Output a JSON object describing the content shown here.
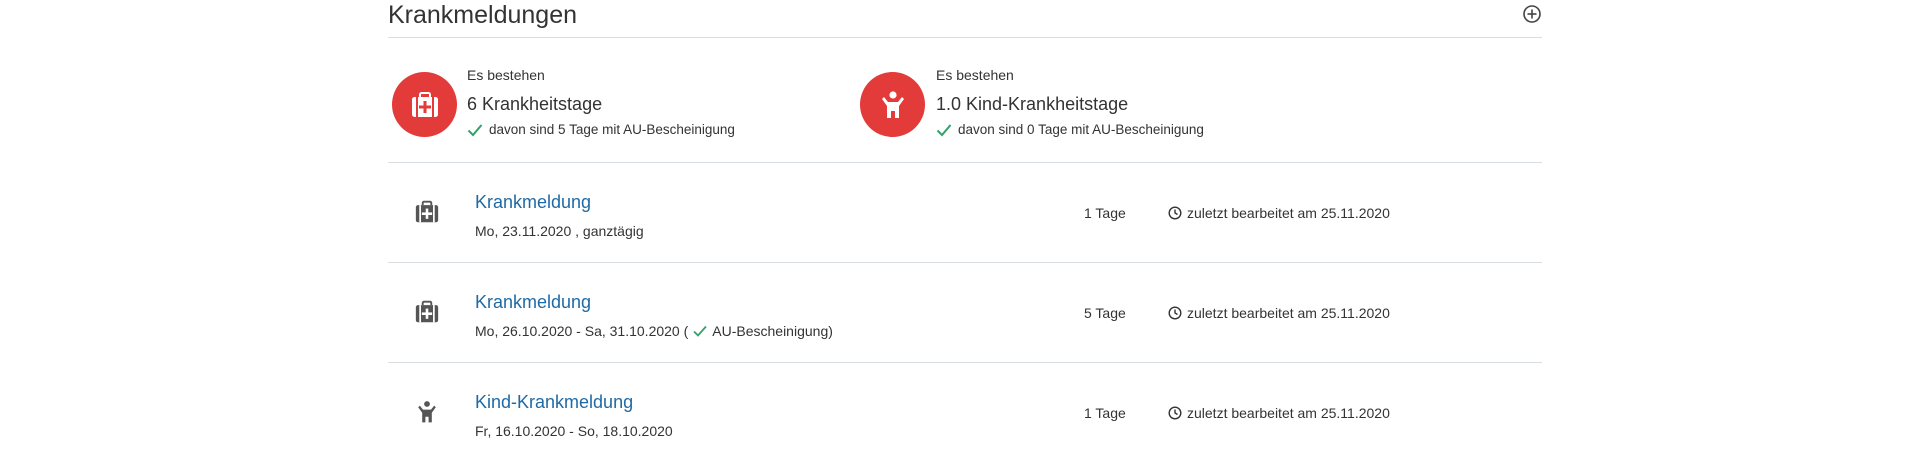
{
  "header": {
    "title": "Krankmeldungen",
    "add_icon": "plus-circle-icon"
  },
  "summary": {
    "sick": {
      "pre": "Es bestehen",
      "count": "6 Krankheitstage",
      "note": "davon sind 5 Tage mit AU-Bescheinigung",
      "icon": "medical-bag-icon"
    },
    "child": {
      "pre": "Es bestehen",
      "count": "1.0 Kind-Krankheitstage",
      "note": "davon sind 0 Tage mit AU-Bescheinigung",
      "icon": "child-icon"
    }
  },
  "rows": [
    {
      "title": "Krankmeldung",
      "sub": "Mo, 23.11.2020 , ganztägig",
      "days": "1 Tage",
      "edited": "zuletzt bearbeitet am 25.11.2020",
      "icon": "medical-bag-icon"
    },
    {
      "title": "Krankmeldung",
      "sub_pre": "Mo, 26.10.2020 - Sa, 31.10.2020 (",
      "sub_au": "AU-Bescheinigung)",
      "days": "5 Tage",
      "edited": "zuletzt bearbeitet am 25.11.2020",
      "icon": "medical-bag-icon"
    },
    {
      "title": "Kind-Krankmeldung",
      "sub": "Fr, 16.10.2020 - So, 18.10.2020",
      "days": "1 Tage",
      "edited": "zuletzt bearbeitet am 25.11.2020",
      "icon": "child-icon"
    }
  ],
  "colors": {
    "accent_red": "#e33a3a",
    "link_blue": "#1f6aa5",
    "check_green": "#2fa36b",
    "icon_gray": "#555555"
  }
}
